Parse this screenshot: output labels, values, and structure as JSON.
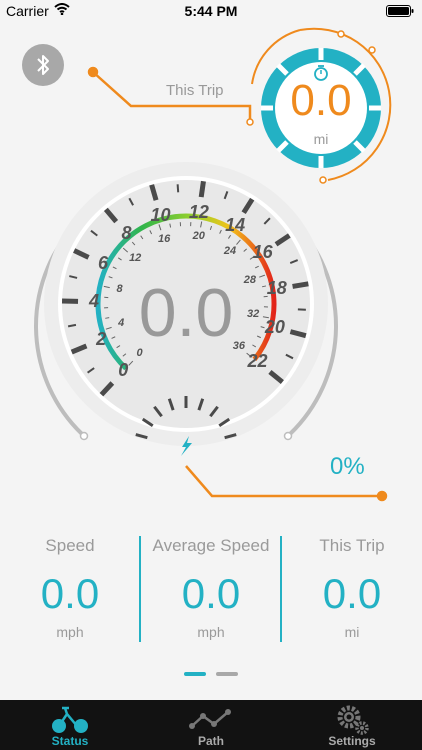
{
  "status_bar": {
    "carrier": "Carrier",
    "time": "5:44 PM"
  },
  "trip_badge": {
    "label": "This Trip",
    "value": "0.0",
    "unit": "mi"
  },
  "speedometer": {
    "value": "0.0",
    "outer_ticks": [
      "0",
      "2",
      "4",
      "6",
      "8",
      "10",
      "12",
      "14",
      "16",
      "18",
      "20",
      "22"
    ],
    "inner_ticks": [
      "0",
      "4",
      "8",
      "12",
      "16",
      "20",
      "24",
      "28",
      "32",
      "36"
    ]
  },
  "battery": {
    "percent": "0%",
    "level": 0
  },
  "stats": [
    {
      "label": "Speed",
      "value": "0.0",
      "unit": "mph"
    },
    {
      "label": "Average Speed",
      "value": "0.0",
      "unit": "mph"
    },
    {
      "label": "This Trip",
      "value": "0.0",
      "unit": "mi"
    }
  ],
  "pager": {
    "pages": 2,
    "active": 0
  },
  "tabs": [
    {
      "label": "Status",
      "icon": "bicycle-icon",
      "active": true
    },
    {
      "label": "Path",
      "icon": "path-icon",
      "active": false
    },
    {
      "label": "Settings",
      "icon": "gears-icon",
      "active": false
    }
  ],
  "colors": {
    "accent": "#23b1c4",
    "orange": "#ef8a1d",
    "gray": "#9a9a9a",
    "tabbar": "#121212"
  }
}
